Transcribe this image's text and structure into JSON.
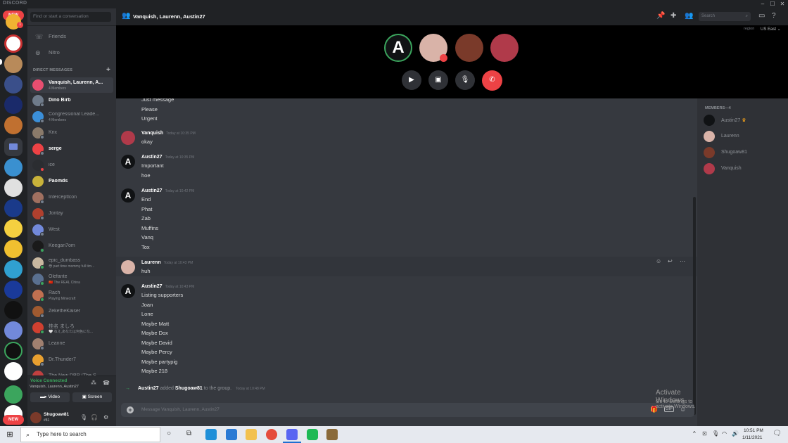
{
  "app": {
    "brand": "DISCORD"
  },
  "guild_rail": {
    "new_badge_top": "NEW",
    "new_badge_bottom": "NEW",
    "mention_count": "1"
  },
  "dm_column": {
    "search_placeholder": "Find or start a conversation",
    "nav": [
      {
        "label": "Friends"
      },
      {
        "label": "Nitro"
      }
    ],
    "section_title": "DIRECT MESSAGES",
    "items": [
      {
        "name": "Vanquish, Laurenn, A...",
        "sub": "4 Members",
        "color": "#e84e70",
        "selected": true,
        "bold": true
      },
      {
        "name": "Dino Birb",
        "sub": "",
        "color": "#6f7b8a",
        "bold": true
      },
      {
        "name": "Congressional Leade...",
        "sub": "4 Members",
        "color": "#3b8fd8"
      },
      {
        "name": "Krix",
        "sub": "",
        "color": "#8a7a6a"
      },
      {
        "name": "serge",
        "sub": "",
        "color": "#ed4245",
        "bold": true
      },
      {
        "name": "ice",
        "sub": "",
        "color": "#2b2d31"
      },
      {
        "name": "Paomds",
        "sub": "",
        "color": "#c8b23a",
        "bold": true
      },
      {
        "name": "Interceptlcon",
        "sub": "",
        "color": "#a07060"
      },
      {
        "name": "Jontay",
        "sub": "",
        "color": "#b0402e"
      },
      {
        "name": "West",
        "sub": "",
        "color": "#7289da"
      },
      {
        "name": "Keegan7om",
        "sub": "",
        "color": "#1a1a1a"
      },
      {
        "name": "epic_dumbass",
        "sub": "😳 part time mommy full tim...",
        "color": "#c9b8a0"
      },
      {
        "name": "Olefante",
        "sub": "🇨🇳 The REAL China",
        "color": "#5a7090"
      },
      {
        "name": "Rach",
        "sub": "Playing Minecraft",
        "color": "#c07050"
      },
      {
        "name": "ZeketheKaiser",
        "sub": "",
        "color": "#a05a30"
      },
      {
        "name": "桂名 ましろ",
        "sub": "🤍 ねえ,あなたは何色にな...",
        "color": "#d04030"
      },
      {
        "name": "Leanne",
        "sub": "",
        "color": "#a08070"
      },
      {
        "name": "Dr.Thunder7",
        "sub": "",
        "color": "#e8a030"
      },
      {
        "name": "The New DBR (The S...",
        "sub": "",
        "color": "#c04040"
      }
    ]
  },
  "voice_panel": {
    "status": "Voice Connected",
    "channel": "Vanquish, Laurenn, Austin27",
    "video_label": "Video",
    "screen_label": "Screen"
  },
  "user_panel": {
    "name": "Shugoaw81",
    "tag": "#81"
  },
  "header": {
    "title": "Vanquish, Laurenn, Austin27",
    "search_placeholder": "Search",
    "region_label": "region",
    "region_value": "US East"
  },
  "messages": [
    {
      "lines": [
        "Just message",
        "Please",
        "Urgent"
      ]
    },
    {
      "author": "Vanquish",
      "time": "Today at 10:35 PM",
      "lines": [
        "okay"
      ],
      "color": "#b03a4a"
    },
    {
      "author": "Austin27",
      "time": "Today at 10:35 PM",
      "lines": [
        "Important",
        "hoe"
      ],
      "color": "#101214"
    },
    {
      "author": "Austin27",
      "time": "Today at 10:42 PM",
      "lines": [
        "End",
        "Phat",
        "Zab",
        "Muffins",
        "Vanq",
        "Tox"
      ],
      "color": "#101214"
    },
    {
      "author": "Laurenn",
      "time": "Today at 10:43 PM",
      "lines": [
        "huh"
      ],
      "color": "#d9b3a8"
    },
    {
      "author": "Austin27",
      "time": "Today at 10:43 PM",
      "lines": [
        "Listing supporters",
        "Joan",
        "Lone",
        "Maybe Matt",
        "Maybe Dox",
        "Maybe David",
        "Maybe Percy",
        "Maybe partypig",
        "Maybe 218"
      ],
      "color": "#101214"
    }
  ],
  "system_message": {
    "actor": "Austin27",
    "verb": "added",
    "target": "Shugoaw81",
    "suffix": "to the group.",
    "time": "Today at 10:48 PM"
  },
  "composer": {
    "placeholder": "Message Vanquish, Laurenn, Austin27"
  },
  "members": {
    "title": "MEMBERS—4",
    "list": [
      {
        "name": "Austin27",
        "color": "#101214",
        "owner": true
      },
      {
        "name": "Laurenn",
        "color": "#d9b3a8"
      },
      {
        "name": "Shugoaw81",
        "color": "#7a3a2a"
      },
      {
        "name": "Vanquish",
        "color": "#b03a4a"
      }
    ]
  },
  "watermark": {
    "line1": "Activate Windows",
    "line2": "Go to Settings to activate Windows."
  },
  "taskbar": {
    "search_placeholder": "Type here to search",
    "time": "10:51 PM",
    "date": "1/11/2021"
  }
}
